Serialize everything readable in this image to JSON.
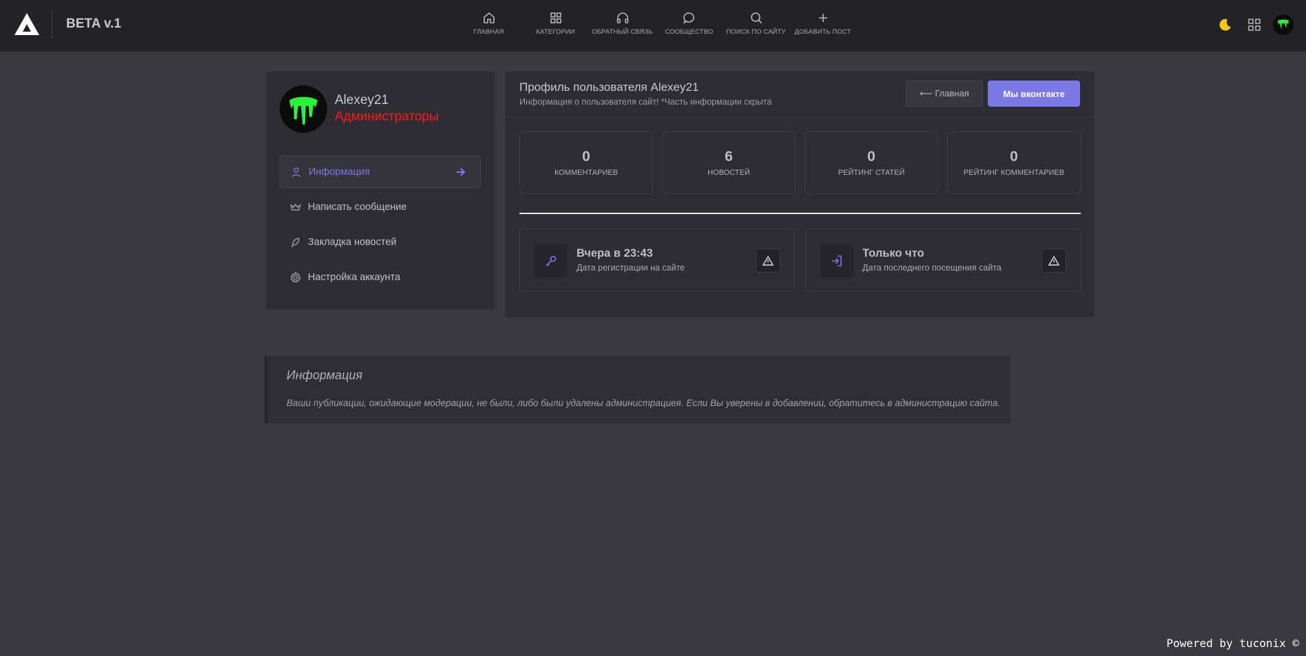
{
  "header": {
    "brand": "BETA v.1",
    "nav": [
      {
        "label": "ГЛАВНАЯ",
        "icon": "home-icon"
      },
      {
        "label": "КАТЕГОРИИ",
        "icon": "grid-icon"
      },
      {
        "label": "ОБРАТНЫЙ СВЯЗЬ",
        "icon": "headphones-icon"
      },
      {
        "label": "СООБЩЕСТВО",
        "icon": "chat-bubble-icon"
      },
      {
        "label": "ПОИСК ПО САЙТУ",
        "icon": "search-icon"
      },
      {
        "label": "ДОБАВИТЬ ПОСТ",
        "icon": "plus-icon"
      }
    ],
    "theme_icon": "moon-icon",
    "apps_icon": "apps-grid-icon"
  },
  "profile": {
    "name": "Alexey21",
    "group": "Администраторы",
    "group_color": "#ff1a1a",
    "menu": [
      {
        "label": "Информация",
        "icon": "user-icon",
        "active": true
      },
      {
        "label": "Написать сообщение",
        "icon": "crown-icon",
        "active": false
      },
      {
        "label": "Закладка новостей",
        "icon": "feather-icon",
        "active": false
      },
      {
        "label": "Настройка аккаунта",
        "icon": "gear-icon",
        "active": false
      }
    ]
  },
  "main": {
    "title": "Профиль пользователя Alexey21",
    "subtitle": "Информация о пользователя сайт! *Часть информации скрыта",
    "home_button": "⟵ Главная",
    "vk_button": "Мы вконтакте",
    "stats": [
      {
        "value": "0",
        "label": "КОММЕНТАРИЕВ"
      },
      {
        "value": "6",
        "label": "НОВОСТЕЙ"
      },
      {
        "value": "0",
        "label": "РЕЙТИНГ СТАТЕЙ"
      },
      {
        "value": "0",
        "label": "РЕЙТИНГ КОММЕНТАРИЕВ"
      }
    ],
    "info": [
      {
        "value": "Вчера в 23:43",
        "label": "Дата регистрации на сайте",
        "icon": "key-icon"
      },
      {
        "value": "Только что",
        "label": "Дата последнего посещения сайта",
        "icon": "login-icon"
      }
    ]
  },
  "notice": {
    "title": "Информация",
    "text": "Ваши публикации, ожидающие модерации, не были, либо были удалены администрациея. Если Вы уверены в добавлении, обратитесь в администрацию сайта."
  },
  "footer": {
    "powered": "Powered by tuconix ©"
  },
  "colors": {
    "accent": "#7b79e8",
    "background": "#3a3940",
    "topbar": "#232326"
  }
}
